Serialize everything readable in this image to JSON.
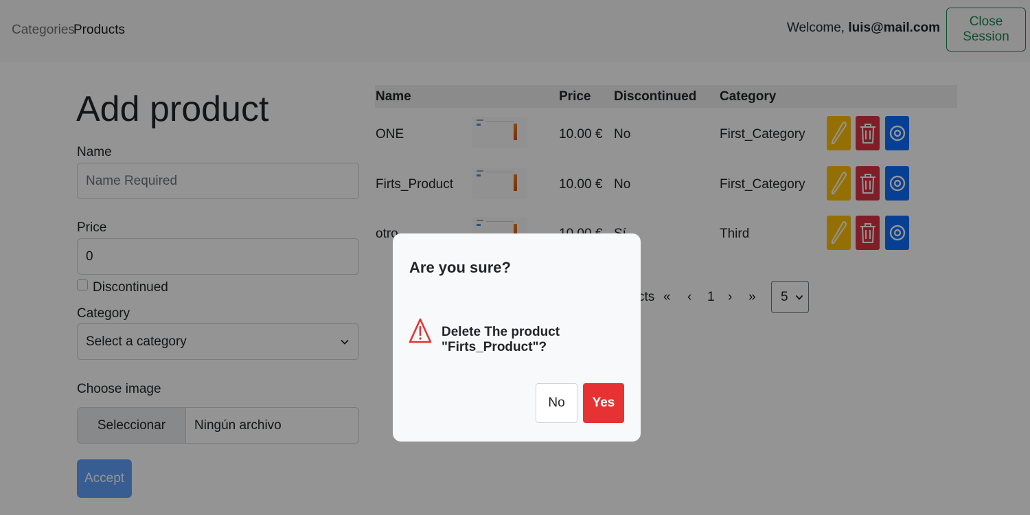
{
  "nav": {
    "links": [
      "Categories",
      "Products"
    ],
    "active": "Products",
    "welcome_prefix": "Welcome,",
    "user_email": "luis@mail.com",
    "close_session": "Close Session"
  },
  "form": {
    "title": "Add product",
    "name_label": "Name",
    "name_placeholder": "Name Required",
    "price_label": "Price",
    "price_value": "0",
    "discontinued_label": "Discontinued",
    "discontinued_checked": false,
    "category_label": "Category",
    "category_selected": "Select a category",
    "image_label": "Choose image",
    "file_button": "Seleccionar archivo",
    "file_status": "Ningún archivo seleccionado",
    "accept_button": "Accept"
  },
  "table": {
    "headers": [
      "Name",
      "Price",
      "Discontinued",
      "Category"
    ],
    "rows": [
      {
        "name": "ONE",
        "price": "10.00 €",
        "discontinued": "No",
        "category": "First_Category"
      },
      {
        "name": "Firts_Product",
        "price": "10.00 €",
        "discontinued": "No",
        "category": "First_Category"
      },
      {
        "name": "otro",
        "price": "10.00 €",
        "discontinued": "Sí",
        "category": "Third"
      }
    ],
    "action_icons": [
      "pencil-icon",
      "trash-icon",
      "eye-icon"
    ]
  },
  "pagination": {
    "summary_fragment": "cts",
    "first": "«",
    "prev": "‹",
    "page": "1",
    "next": "›",
    "last": "»",
    "page_size": "5"
  },
  "modal": {
    "title": "Are you sure?",
    "message": "Delete The product \"Firts_Product\"?",
    "no_button": "No",
    "yes_button": "Yes",
    "icon": "warning-triangle-icon"
  },
  "colors": {
    "primary": "#0d6efd",
    "warning": "#ffc107",
    "danger": "#dc3545",
    "success": "#198754",
    "confirm": "#e63232"
  }
}
